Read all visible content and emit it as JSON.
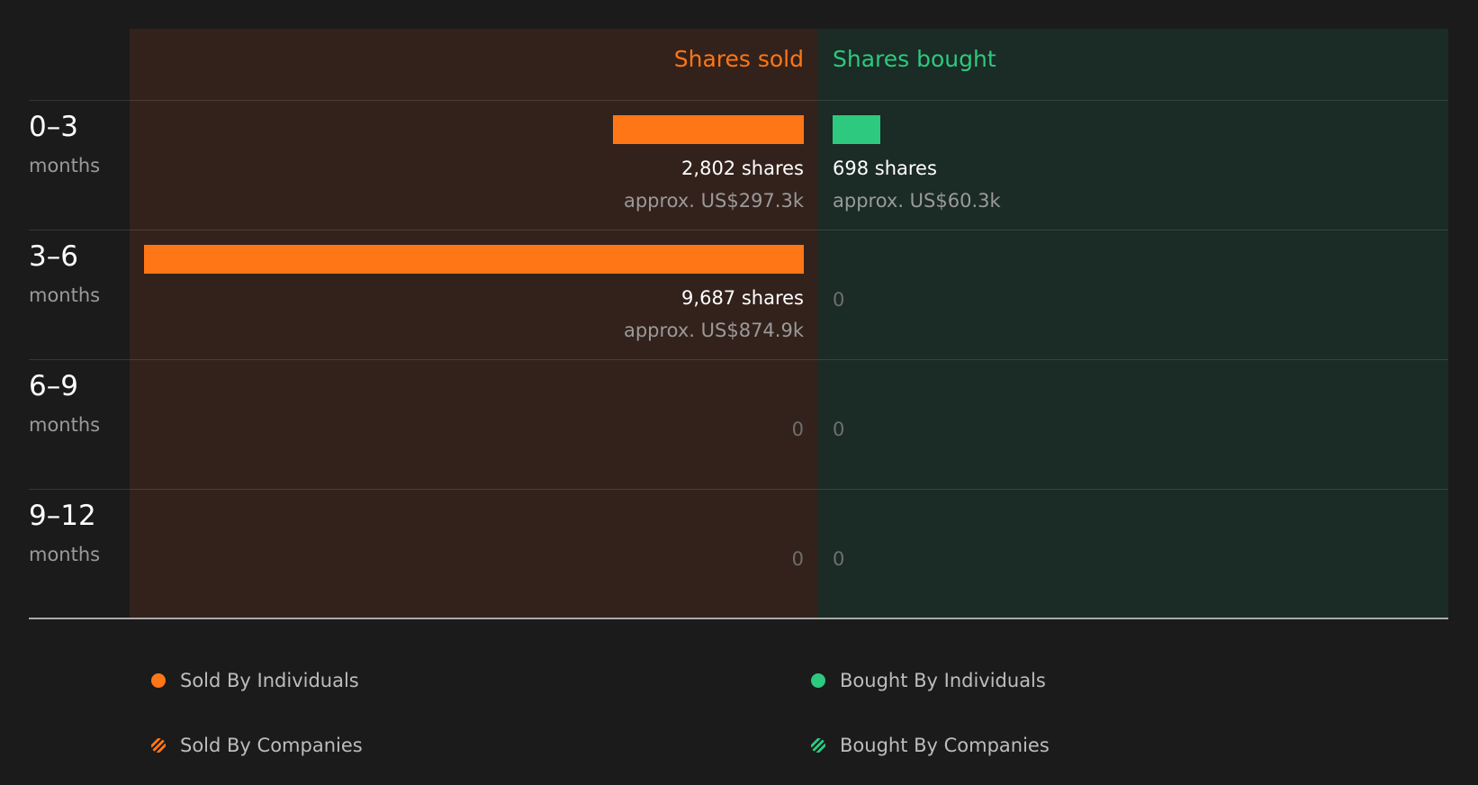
{
  "headers": {
    "sold": "Shares sold",
    "bought": "Shares bought"
  },
  "rows": [
    {
      "range": "0–3",
      "unit": "months",
      "sold": {
        "shares_label": "2,802 shares",
        "approx_label": "approx. US$297.3k"
      },
      "bought": {
        "shares_label": "698 shares",
        "approx_label": "approx. US$60.3k"
      }
    },
    {
      "range": "3–6",
      "unit": "months",
      "sold": {
        "shares_label": "9,687 shares",
        "approx_label": "approx. US$874.9k"
      },
      "bought": {
        "zero_label": "0"
      }
    },
    {
      "range": "6–9",
      "unit": "months",
      "sold": {
        "zero_label": "0"
      },
      "bought": {
        "zero_label": "0"
      }
    },
    {
      "range": "9–12",
      "unit": "months",
      "sold": {
        "zero_label": "0"
      },
      "bought": {
        "zero_label": "0"
      }
    }
  ],
  "legend": {
    "sold_individuals": "Sold By Individuals",
    "bought_individuals": "Bought By Individuals",
    "sold_companies": "Sold By Companies",
    "bought_companies": "Bought By Companies"
  },
  "colors": {
    "sold": "#ff7617",
    "bought": "#2dc97e",
    "sold_panel": "#33221b",
    "bought_panel": "#1b2b25",
    "background": "#1b1b1b"
  },
  "chart_data": {
    "type": "bar",
    "orientation": "horizontal-diverging",
    "categories": [
      "0–3 months",
      "3–6 months",
      "6–9 months",
      "9–12 months"
    ],
    "series": [
      {
        "name": "Shares sold",
        "values": [
          2802,
          9687,
          0,
          0
        ]
      },
      {
        "name": "Shares bought",
        "values": [
          698,
          0,
          0,
          0
        ]
      }
    ],
    "approx_value_usd_k": {
      "sold": [
        297.3,
        874.9,
        0,
        0
      ],
      "bought": [
        60.3,
        0,
        0,
        0
      ]
    },
    "max_value": 9687,
    "legend": [
      "Sold By Individuals",
      "Bought By Individuals",
      "Sold By Companies",
      "Bought By Companies"
    ],
    "legend_placement": "bottom"
  }
}
